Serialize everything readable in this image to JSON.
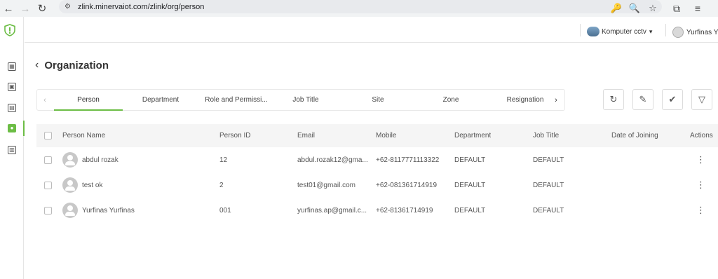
{
  "browser": {
    "url": "zlink.minervaiot.com/zlink/org/person",
    "back_icon": "←",
    "forward_icon": "→",
    "reload_icon": "↻",
    "site_settings_icon": "⚙",
    "address_icons": [
      "🔑",
      "🔍",
      "☆"
    ],
    "toolbar_icons": [
      "⧉",
      "≡"
    ]
  },
  "header": {
    "site_name": "Komputer cctv",
    "user_name": "Yurfinas Y"
  },
  "sidebar": {
    "items": [
      {
        "name": "dashboard",
        "glyph": "▦"
      },
      {
        "name": "device",
        "glyph": "▣"
      },
      {
        "name": "transport",
        "glyph": "▤"
      },
      {
        "name": "organization",
        "glyph": "●",
        "active": true
      },
      {
        "name": "document",
        "glyph": "▥"
      }
    ]
  },
  "page": {
    "title": "Organization"
  },
  "tabs": [
    {
      "label": "Person",
      "active": true
    },
    {
      "label": "Department"
    },
    {
      "label": "Role and Permissi..."
    },
    {
      "label": "Job Title"
    },
    {
      "label": "Site"
    },
    {
      "label": "Zone"
    },
    {
      "label": "Resignation"
    }
  ],
  "tab_scroll": {
    "left": "‹",
    "right": "›"
  },
  "toolbar": {
    "refresh_icon": "↻",
    "edit_icon": "✎",
    "edit_check_icon": "✔",
    "filter_icon": "▽"
  },
  "table": {
    "columns": [
      "Person Name",
      "Person ID",
      "Email",
      "Mobile",
      "Department",
      "Job Title",
      "Date of Joining",
      "Actions"
    ],
    "rows": [
      {
        "name": "abdul rozak",
        "id": "12",
        "email": "abdul.rozak12@gma...",
        "mobile": "+62-8117771113322",
        "department": "DEFAULT",
        "job_title": "DEFAULT",
        "date_of_joining": ""
      },
      {
        "name": "test ok",
        "id": "2",
        "email": "test01@gmail.com",
        "mobile": "+62-081361714919",
        "department": "DEFAULT",
        "job_title": "DEFAULT",
        "date_of_joining": ""
      },
      {
        "name": "Yurfinas Yurfinas",
        "id": "001",
        "email": "yurfinas.ap@gmail.c...",
        "mobile": "+62-81361714919",
        "department": "DEFAULT",
        "job_title": "DEFAULT",
        "date_of_joining": ""
      }
    ]
  },
  "colors": {
    "accent": "#6cbd45"
  }
}
